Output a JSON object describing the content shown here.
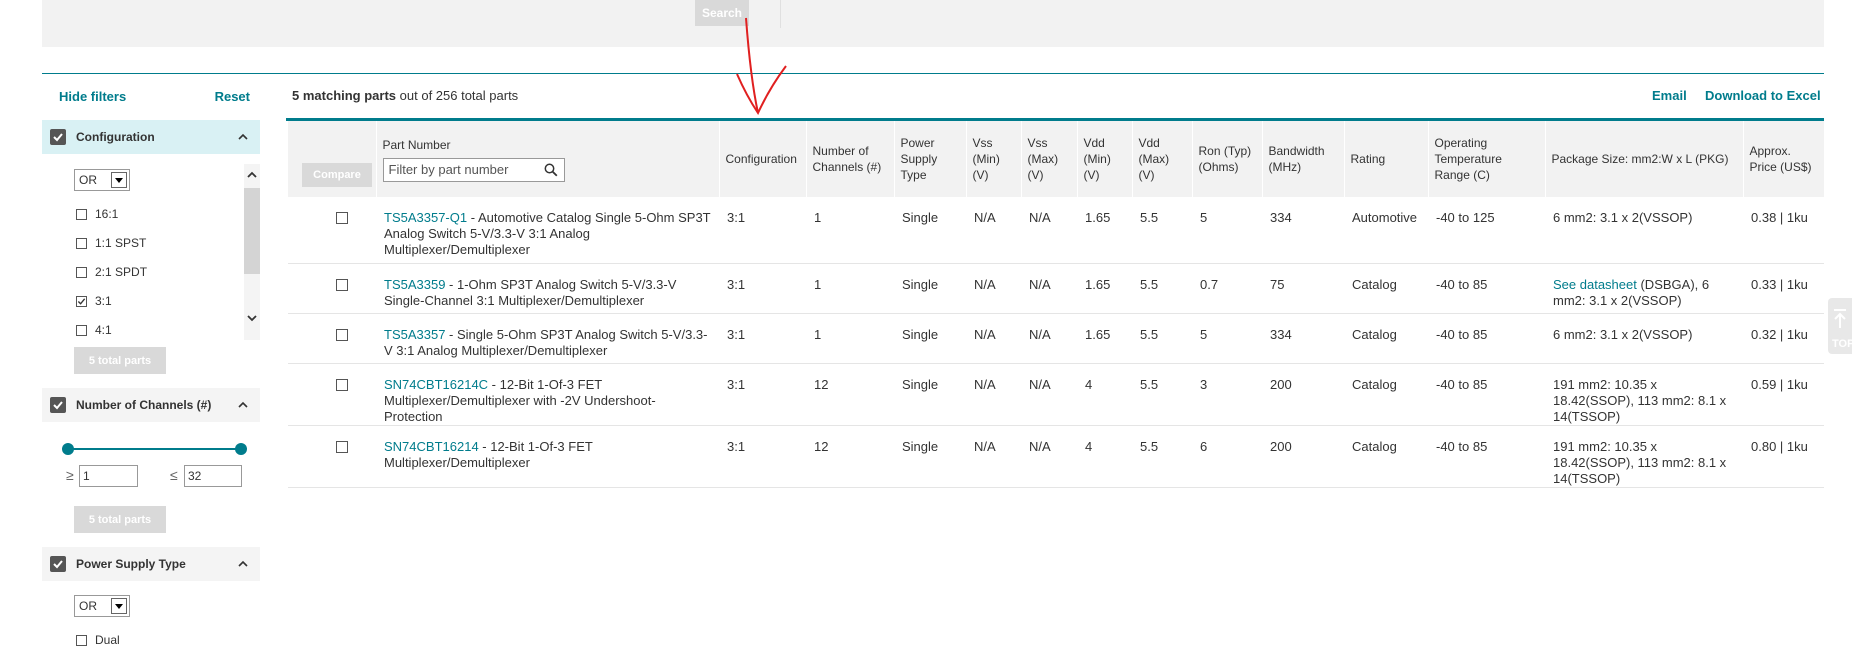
{
  "top": {
    "search_label": "Search"
  },
  "sidebar": {
    "hide_filters": "Hide filters",
    "reset": "Reset",
    "facets": {
      "configuration": {
        "title": "Configuration",
        "logic": "OR",
        "options": [
          {
            "label": "16:1",
            "checked": false
          },
          {
            "label": "1:1 SPST",
            "checked": false
          },
          {
            "label": "2:1 SPDT",
            "checked": false
          },
          {
            "label": "3:1",
            "checked": true
          },
          {
            "label": "4:1",
            "checked": false
          }
        ],
        "total_button": "5 total parts"
      },
      "channels": {
        "title": "Number of Channels (#)",
        "min_symbol": "≥",
        "max_symbol": "≤",
        "min": "1",
        "max": "32",
        "total_button": "5 total parts"
      },
      "power": {
        "title": "Power Supply Type",
        "logic": "OR",
        "options": [
          {
            "label": "Dual",
            "checked": false
          }
        ]
      }
    }
  },
  "results": {
    "count": "5 matching parts",
    "suffix": "out of 256 total parts",
    "email": "Email",
    "download": "Download to Excel",
    "compare": "Compare",
    "filter_placeholder": "Filter by part number",
    "headers": {
      "part": "Part Number",
      "config": "Configuration",
      "channels": "Number of Channels (#)",
      "power": "Power Supply Type",
      "vss_min": "Vss (Min) (V)",
      "vss_max": "Vss (Max) (V)",
      "vdd_min": "Vdd (Min) (V)",
      "vdd_max": "Vdd (Max) (V)",
      "ron": "Ron (Typ) (Ohms)",
      "bw": "Bandwidth (MHz)",
      "rating": "Rating",
      "temp": "Operating Temperature Range (C)",
      "pkg": "Package Size: mm2:W x L (PKG)",
      "price": "Approx. Price (US$)"
    },
    "rows": [
      {
        "pn": "TS5A3357-Q1",
        "desc": " - Automotive Catalog Single 5-Ohm SP3T Analog Switch 5-V/3.3-V 3:1 Analog Multiplexer/Demultiplexer",
        "config": "3:1",
        "channels": "1",
        "power": "Single",
        "vss_min": "N/A",
        "vss_max": "N/A",
        "vdd_min": "1.65",
        "vdd_max": "5.5",
        "ron": "5",
        "bw": "334",
        "rating": "Automotive",
        "temp": "-40 to 125",
        "pkg_link": "",
        "pkg": "6 mm2: 3.1 x 2(VSSOP)",
        "price": "0.38 | 1ku"
      },
      {
        "pn": "TS5A3359",
        "desc": " - 1-Ohm SP3T Analog Switch 5-V/3.3-V Single-Channel 3:1 Multiplexer/Demultiplexer",
        "config": "3:1",
        "channels": "1",
        "power": "Single",
        "vss_min": "N/A",
        "vss_max": "N/A",
        "vdd_min": "1.65",
        "vdd_max": "5.5",
        "ron": "0.7",
        "bw": "75",
        "rating": "Catalog",
        "temp": "-40 to 85",
        "pkg_link": "See datasheet",
        "pkg": " (DSBGA), 6 mm2: 3.1 x 2(VSSOP)",
        "price": "0.33 | 1ku"
      },
      {
        "pn": "TS5A3357",
        "desc": " - Single 5-Ohm SP3T Analog Switch 5-V/3.3-V 3:1 Analog Multiplexer/Demultiplexer",
        "config": "3:1",
        "channels": "1",
        "power": "Single",
        "vss_min": "N/A",
        "vss_max": "N/A",
        "vdd_min": "1.65",
        "vdd_max": "5.5",
        "ron": "5",
        "bw": "334",
        "rating": "Catalog",
        "temp": "-40 to 85",
        "pkg_link": "",
        "pkg": "6 mm2: 3.1 x 2(VSSOP)",
        "price": "0.32 | 1ku"
      },
      {
        "pn": "SN74CBT16214C",
        "desc": " - 12-Bit 1-Of-3 FET Multiplexer/Demultiplexer with -2V Undershoot-Protection",
        "config": "3:1",
        "channels": "12",
        "power": "Single",
        "vss_min": "N/A",
        "vss_max": "N/A",
        "vdd_min": "4",
        "vdd_max": "5.5",
        "ron": "3",
        "bw": "200",
        "rating": "Catalog",
        "temp": "-40 to 85",
        "pkg_link": "",
        "pkg": "191 mm2: 10.35 x 18.42(SSOP), 113 mm2: 8.1 x 14(TSSOP)",
        "price": "0.59 | 1ku"
      },
      {
        "pn": "SN74CBT16214",
        "desc": " - 12-Bit 1-Of-3 FET Multiplexer/Demultiplexer",
        "config": "3:1",
        "channels": "12",
        "power": "Single",
        "vss_min": "N/A",
        "vss_max": "N/A",
        "vdd_min": "4",
        "vdd_max": "5.5",
        "ron": "6",
        "bw": "200",
        "rating": "Catalog",
        "temp": "-40 to 85",
        "pkg_link": "",
        "pkg": "191 mm2: 10.35 x 18.42(SSOP), 113 mm2: 8.1 x 14(TSSOP)",
        "price": "0.80 | 1ku"
      }
    ]
  },
  "side_tab": {
    "label": "TOP"
  },
  "colors": {
    "accent": "#007c8c",
    "annotation": "#e02020"
  }
}
